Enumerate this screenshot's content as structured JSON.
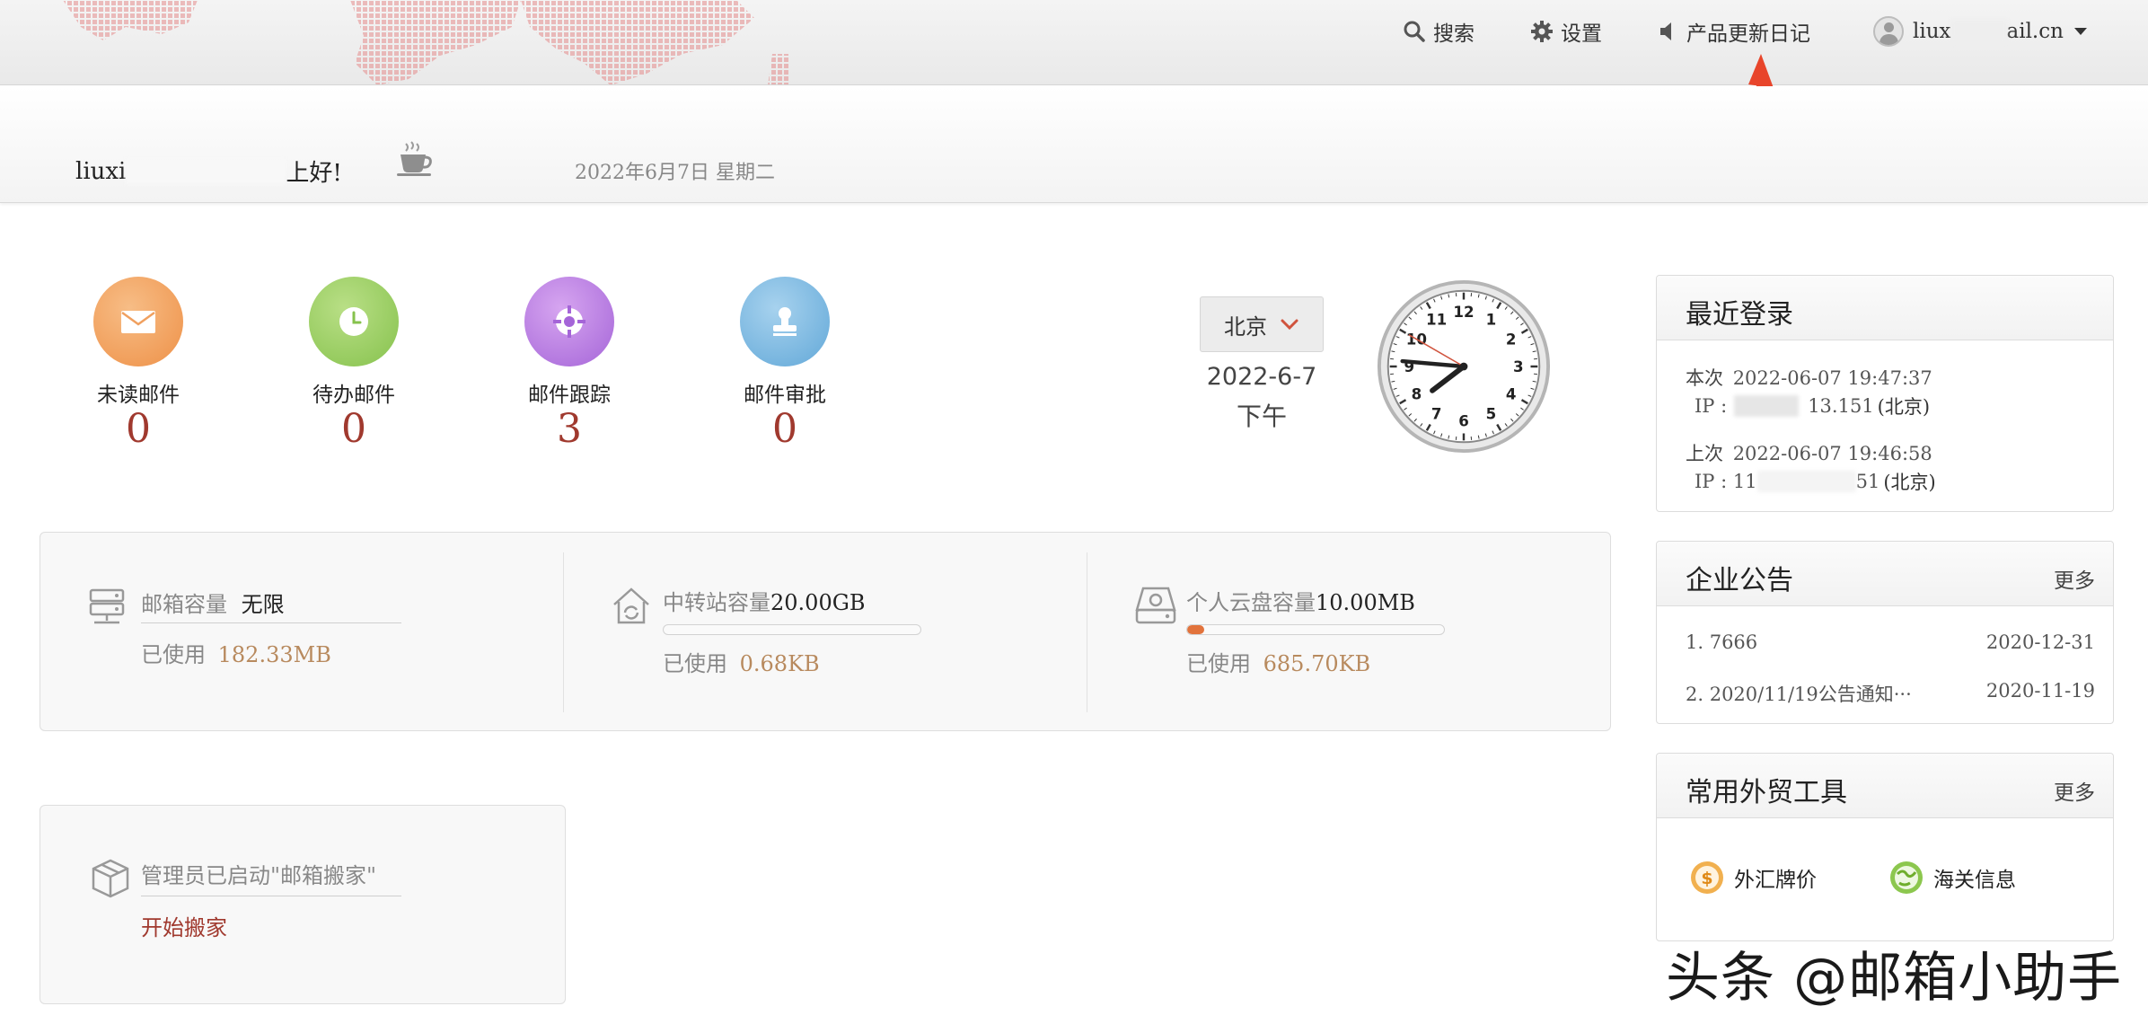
{
  "topbar": {
    "search_label": "搜索",
    "settings_label": "设置",
    "changelog_label": "产品更新日记",
    "user_prefix": "liux",
    "user_suffix": "ail.cn"
  },
  "greeting": {
    "name_prefix": "liuxi",
    "greeting_suffix": "上好!",
    "date": "2022年6月7日 星期二"
  },
  "quick_links": [
    {
      "label": "未读邮件",
      "count": "0",
      "icon": "envelope-icon",
      "color": "#f0a05f"
    },
    {
      "label": "待办邮件",
      "count": "0",
      "icon": "clock-icon",
      "color": "#92c95a"
    },
    {
      "label": "邮件跟踪",
      "count": "3",
      "icon": "target-icon",
      "color": "#b979e0"
    },
    {
      "label": "邮件审批",
      "count": "0",
      "icon": "stamp-icon",
      "color": "#7ab5dc"
    }
  ],
  "weather": {
    "city": "北京",
    "date": "2022-6-7",
    "ampm": "下午"
  },
  "clock": {
    "hour": 7,
    "minute": 45,
    "second": 50
  },
  "storage": {
    "mailbox": {
      "label": "邮箱容量",
      "capacity": "无限",
      "used_label": "已使用",
      "used_value": "182.33MB"
    },
    "transfer": {
      "label": "中转站容量",
      "capacity": "20.00GB",
      "used_label": "已使用",
      "used_value": "0.68KB",
      "progress": 0.0
    },
    "cloud": {
      "label": "个人云盘容量",
      "capacity": "10.00MB",
      "used_label": "已使用",
      "used_value": "685.70KB",
      "progress": 0.067
    }
  },
  "migration": {
    "notice": "管理员已启动\"邮箱搬家\"",
    "action": "开始搬家"
  },
  "recent_login": {
    "title": "最近登录",
    "current_label": "本次",
    "current_time": "2022-06-07 19:47:37",
    "current_ip_label": "IP :",
    "current_ip_tail": "13.151",
    "current_location": "(北京)",
    "last_label": "上次",
    "last_time": "2022-06-07 19:46:58",
    "last_ip_label": "IP : 11",
    "last_ip_tail": "51",
    "last_location": "(北京)"
  },
  "announcements": {
    "title": "企业公告",
    "more": "更多",
    "items": [
      {
        "text": "1. 7666",
        "date": "2020-12-31"
      },
      {
        "text": "2. 2020/11/19公告通知···",
        "date": "2020-11-19"
      }
    ]
  },
  "tools": {
    "title": "常用外贸工具",
    "more": "更多",
    "items": [
      {
        "label": "外汇牌价",
        "icon": "dollar-coin-icon"
      },
      {
        "label": "海关信息",
        "icon": "globe-icon"
      }
    ]
  },
  "watermark": "头条 @邮箱小助手"
}
